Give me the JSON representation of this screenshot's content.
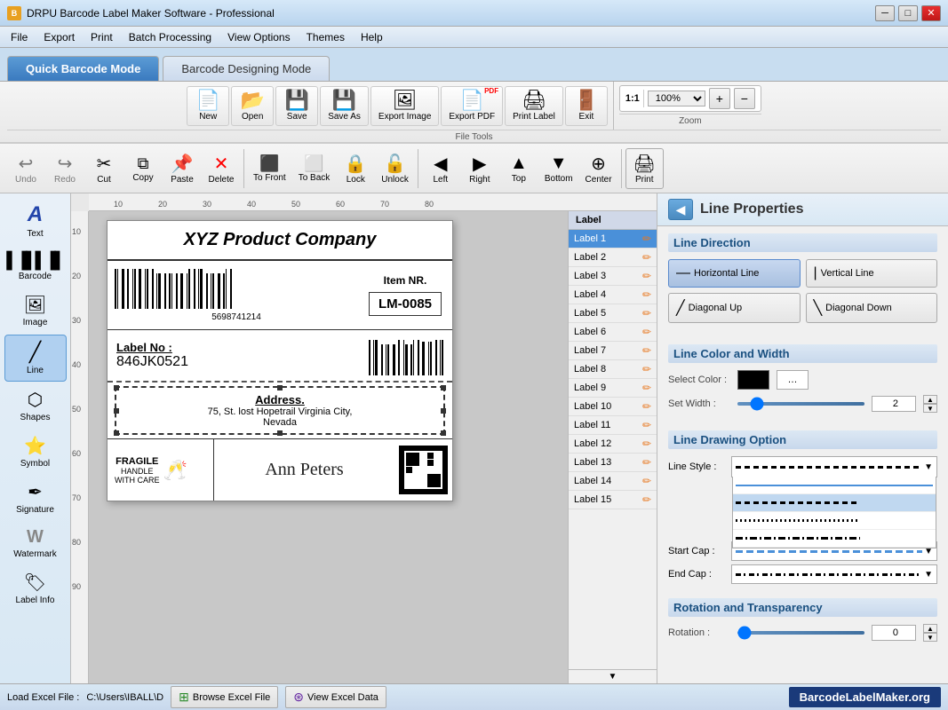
{
  "window": {
    "title": "DRPU Barcode Label Maker Software - Professional",
    "icon": "📊"
  },
  "menu": {
    "items": [
      "File",
      "Export",
      "Print",
      "Batch Processing",
      "View Options",
      "Themes",
      "Help"
    ]
  },
  "mode_tabs": {
    "tabs": [
      "Quick Barcode Mode",
      "Barcode Designing Mode"
    ],
    "active": 0
  },
  "file_tools": {
    "label": "File Tools",
    "buttons": [
      {
        "label": "New",
        "icon": "📄"
      },
      {
        "label": "Open",
        "icon": "📂"
      },
      {
        "label": "Save",
        "icon": "💾"
      },
      {
        "label": "Save As",
        "icon": "💾"
      },
      {
        "label": "Export Image",
        "icon": "🖼"
      },
      {
        "label": "Export PDF",
        "icon": "📕"
      },
      {
        "label": "Print Label",
        "icon": "🖨"
      },
      {
        "label": "Exit",
        "icon": "🚪"
      }
    ]
  },
  "zoom": {
    "label": "Zoom",
    "ratio": "1:1",
    "percent": "100%"
  },
  "edit_tools": {
    "buttons": [
      {
        "label": "Undo",
        "icon": "↩"
      },
      {
        "label": "Redo",
        "icon": "↪"
      },
      {
        "label": "Cut",
        "icon": "✂"
      },
      {
        "label": "Copy",
        "icon": "📋"
      },
      {
        "label": "Paste",
        "icon": "📌"
      },
      {
        "label": "Delete",
        "icon": "❌"
      },
      {
        "label": "To Front",
        "icon": "⬆"
      },
      {
        "label": "To Back",
        "icon": "⬇"
      },
      {
        "label": "Lock",
        "icon": "🔒"
      },
      {
        "label": "Unlock",
        "icon": "🔓"
      }
    ],
    "align_buttons": [
      {
        "label": "Left",
        "icon": "⬅"
      },
      {
        "label": "Right",
        "icon": "➡"
      },
      {
        "label": "Top",
        "icon": "⬆"
      },
      {
        "label": "Bottom",
        "icon": "⬇"
      },
      {
        "label": "Center",
        "icon": "🎯"
      }
    ],
    "print_label": "Print"
  },
  "left_sidebar": {
    "tools": [
      {
        "label": "Text",
        "icon": "A"
      },
      {
        "label": "Barcode",
        "icon": "|||"
      },
      {
        "label": "Image",
        "icon": "🖼"
      },
      {
        "label": "Line",
        "icon": "—"
      },
      {
        "label": "Shapes",
        "icon": "⬡"
      },
      {
        "label": "Symbol",
        "icon": "⭐"
      },
      {
        "label": "Signature",
        "icon": "✒"
      },
      {
        "label": "Watermark",
        "icon": "W"
      },
      {
        "label": "Label Info",
        "icon": "🏷"
      }
    ]
  },
  "label_panel": {
    "header": "Label",
    "items": [
      "Label 1",
      "Label 2",
      "Label 3",
      "Label 4",
      "Label 5",
      "Label 6",
      "Label 7",
      "Label 8",
      "Label 9",
      "Label 10",
      "Label 11",
      "Label 12",
      "Label 13",
      "Label 14",
      "Label 15"
    ],
    "selected": 0
  },
  "label_content": {
    "company": "XYZ Product Company",
    "item_label": "Item NR.",
    "item_num": "LM-0085",
    "barcode_num": "5698741214",
    "label_no_text": "Label No :",
    "label_no_val": "846JK0521",
    "address_title": "Address.",
    "address_line1": "75, St. lost Hopetrail Virginia City,",
    "address_line2": "Nevada",
    "fragile_main": "FRAGILE",
    "fragile_sub1": "HANDLE",
    "fragile_sub2": "WITH CARE",
    "signature": "Ann Peters"
  },
  "right_panel": {
    "title": "Line Properties",
    "back_btn": "◀",
    "line_direction": {
      "title": "Line Direction",
      "buttons": [
        {
          "label": "Horizontal Line",
          "icon": "—",
          "active": true
        },
        {
          "label": "Vertical Line",
          "icon": "|",
          "active": false
        },
        {
          "label": "Diagonal Up",
          "icon": "╱",
          "active": false
        },
        {
          "label": "Diagonal Down",
          "icon": "╲",
          "active": false
        }
      ]
    },
    "line_color_width": {
      "title": "Line Color and Width",
      "select_color_label": "Select Color :",
      "set_width_label": "Set Width :",
      "width_value": "2"
    },
    "line_drawing": {
      "title": "Line Drawing Option",
      "line_style_label": "Line Style :",
      "start_cap_label": "Start Cap :",
      "end_cap_label": "End Cap :"
    },
    "rotation": {
      "title": "Rotation and Transparency",
      "rotation_label": "Rotation :",
      "rotation_value": "0"
    }
  },
  "status_bar": {
    "load_text": "Load Excel File :",
    "file_path": "C:\\Users\\IBALL\\D",
    "browse_btn": "Browse Excel File",
    "view_btn": "View Excel Data",
    "brand": "BarcodeLabelMaker.org"
  }
}
